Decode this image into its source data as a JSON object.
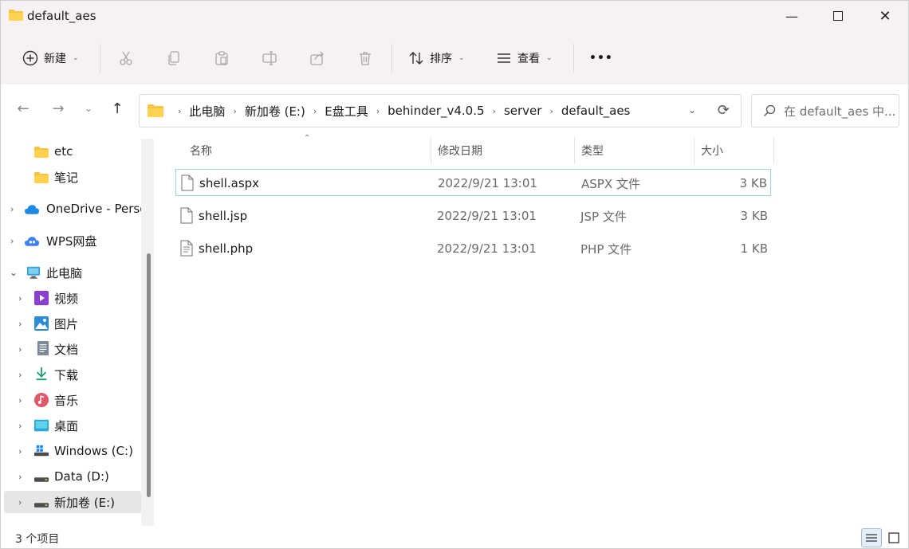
{
  "window": {
    "title": "default_aes",
    "minimize_glyph": "—",
    "close_glyph": "✕"
  },
  "toolbar": {
    "new_label": "新建",
    "sort_label": "排序",
    "view_label": "查看",
    "more_glyph": "•••"
  },
  "address": {
    "crumbs": [
      "此电脑",
      "新加卷 (E:)",
      "E盘工具",
      "behinder_v4.0.5",
      "server",
      "default_aes"
    ]
  },
  "search": {
    "placeholder": "在 default_aes 中..."
  },
  "sidebar": {
    "items": [
      {
        "label": "etc",
        "icon": "folder-icon"
      },
      {
        "label": "笔记",
        "icon": "folder-icon"
      },
      {
        "label": "OneDrive - Personal",
        "icon": "onedrive-icon"
      },
      {
        "label": "WPS网盘",
        "icon": "wps-cloud-icon"
      },
      {
        "label": "此电脑",
        "icon": "this-pc-icon"
      },
      {
        "label": "视频",
        "icon": "videos-icon"
      },
      {
        "label": "图片",
        "icon": "pictures-icon"
      },
      {
        "label": "文档",
        "icon": "documents-icon"
      },
      {
        "label": "下载",
        "icon": "downloads-icon"
      },
      {
        "label": "音乐",
        "icon": "music-icon"
      },
      {
        "label": "桌面",
        "icon": "desktop-icon"
      },
      {
        "label": "Windows (C:)",
        "icon": "drive-c-icon"
      },
      {
        "label": "Data (D:)",
        "icon": "drive-icon"
      },
      {
        "label": "新加卷 (E:)",
        "icon": "drive-icon"
      }
    ]
  },
  "columns": {
    "name": "名称",
    "modified": "修改日期",
    "type": "类型",
    "size": "大小"
  },
  "files": [
    {
      "name": "shell.aspx",
      "modified": "2022/9/21 13:01",
      "type": "ASPX 文件",
      "size": "3 KB"
    },
    {
      "name": "shell.jsp",
      "modified": "2022/9/21 13:01",
      "type": "JSP 文件",
      "size": "3 KB"
    },
    {
      "name": "shell.php",
      "modified": "2022/9/21 13:01",
      "type": "PHP 文件",
      "size": "1 KB"
    }
  ],
  "status": {
    "item_count": "3 个项目"
  },
  "colors": {
    "accent": "#0067c0",
    "folder": "#f4c542",
    "selection_border": "#9fd3da"
  }
}
